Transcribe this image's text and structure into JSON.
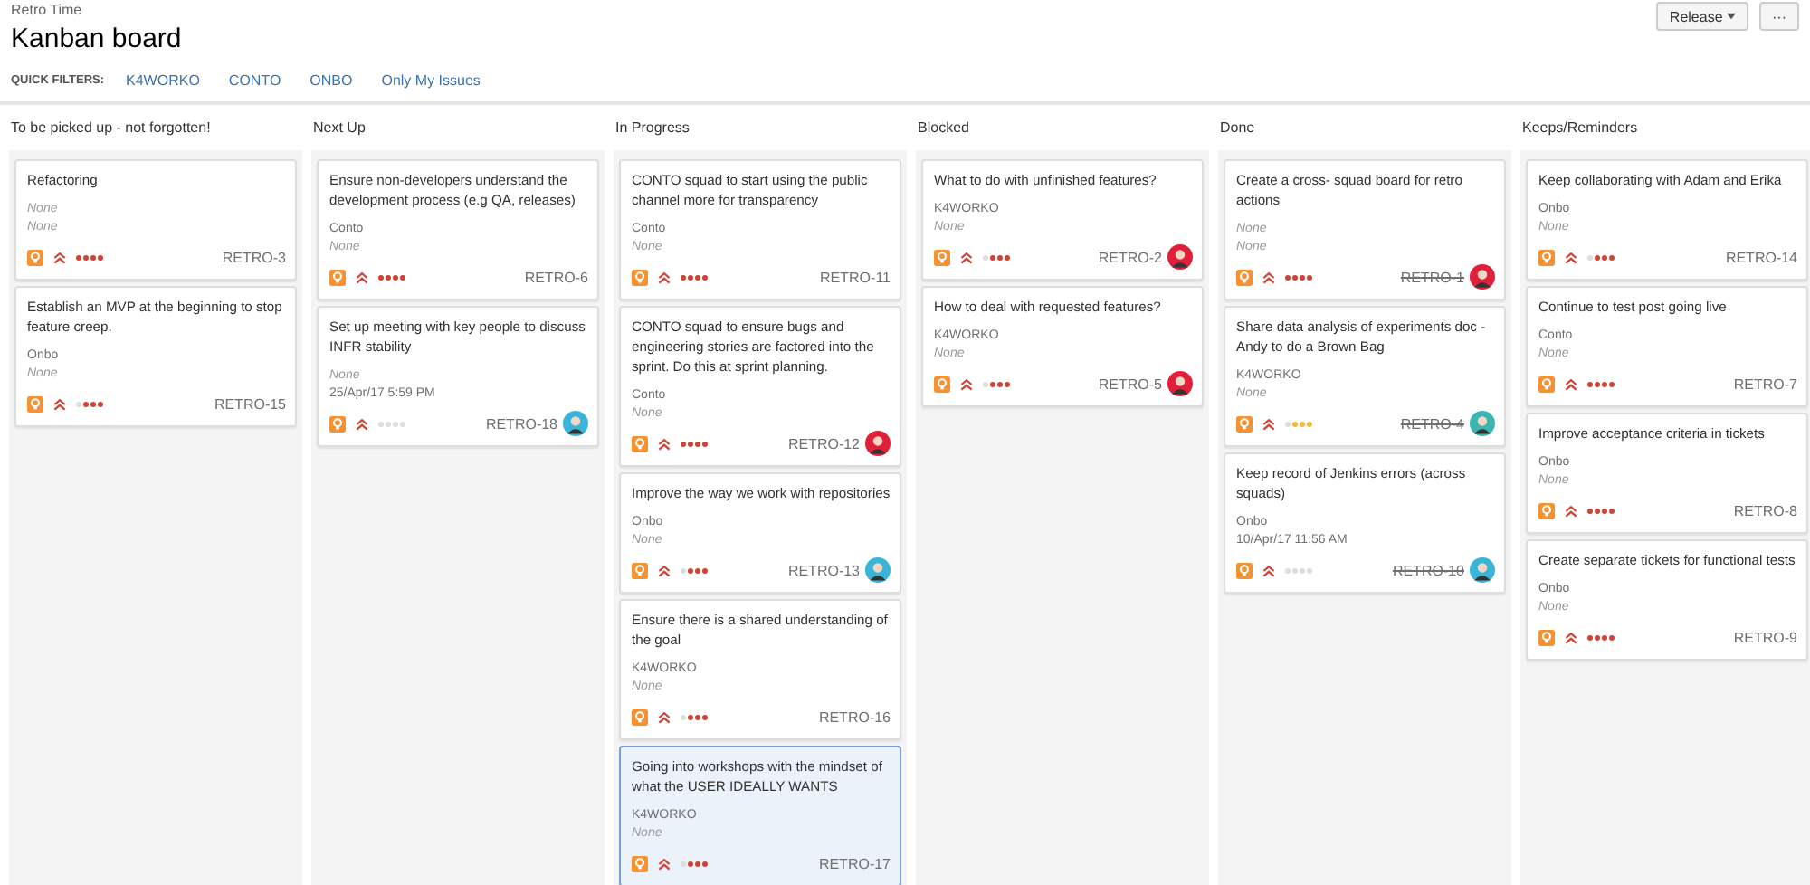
{
  "project": "Retro Time",
  "title": "Kanban board",
  "header_buttons": [
    {
      "label": "Release",
      "kind": "dropdown"
    },
    {
      "label": "···",
      "kind": "more"
    }
  ],
  "quick_filters": {
    "label": "QUICK FILTERS:",
    "items": [
      "K4WORKO",
      "CONTO",
      "ONBO",
      "Only My Issues"
    ]
  },
  "columns": [
    {
      "name": "To be picked up - not forgotten!",
      "cards": [
        {
          "summary": "Refactoring",
          "meta": [
            {
              "text": "None",
              "empty": true
            },
            {
              "text": "None",
              "empty": true
            }
          ],
          "stars": 4,
          "color": "#d04437",
          "key": "RETRO-3",
          "done": false,
          "selected": false
        },
        {
          "summary": "Establish an MVP at the beginning to stop feature creep.",
          "meta": [
            {
              "text": "Onbo",
              "empty": false
            },
            {
              "text": "None",
              "empty": true
            }
          ],
          "stars": 3,
          "color": "#d04437",
          "key": "RETRO-15",
          "done": false,
          "selected": false
        }
      ]
    },
    {
      "name": "Next Up",
      "cards": [
        {
          "summary": "Ensure non-developers understand the development process (e.g QA, releases)",
          "meta": [
            {
              "text": "Conto",
              "empty": false
            },
            {
              "text": "None",
              "empty": true
            }
          ],
          "stars": 4,
          "color": "#d04437",
          "key": "RETRO-6",
          "done": false,
          "selected": false
        },
        {
          "summary": "Set up meeting with key people to discuss INFR stability",
          "meta": [
            {
              "text": "None",
              "empty": true
            },
            {
              "text": "25/Apr/17 5:59 PM",
              "empty": false
            }
          ],
          "stars": 0,
          "key": "RETRO-18",
          "done": false,
          "selected": false,
          "avatar": {
            "color": "#3ab5d9"
          }
        }
      ]
    },
    {
      "name": "In Progress",
      "cards": [
        {
          "summary": "CONTO squad to start using the public channel more for transparency",
          "meta": [
            {
              "text": "Conto",
              "empty": false
            },
            {
              "text": "None",
              "empty": true
            }
          ],
          "stars": 4,
          "color": "#d04437",
          "key": "RETRO-11",
          "done": false,
          "selected": false
        },
        {
          "summary": "CONTO squad to ensure bugs and engineering stories are factored into the sprint. Do this at sprint planning.",
          "meta": [
            {
              "text": "Conto",
              "empty": false
            },
            {
              "text": "None",
              "empty": true
            }
          ],
          "stars": 4,
          "color": "#d04437",
          "key": "RETRO-12",
          "done": false,
          "selected": false,
          "avatar": {
            "color": "#e0203a"
          }
        },
        {
          "summary": "Improve the way we work with repositories",
          "meta": [
            {
              "text": "Onbo",
              "empty": false
            },
            {
              "text": "None",
              "empty": true
            }
          ],
          "stars": 3,
          "color": "#d04437",
          "key": "RETRO-13",
          "done": false,
          "selected": false,
          "avatar": {
            "color": "#3ab5d9"
          }
        },
        {
          "summary": "Ensure there is a shared understanding of the goal",
          "meta": [
            {
              "text": "K4WORKO",
              "empty": false
            },
            {
              "text": "None",
              "empty": true
            }
          ],
          "stars": 3,
          "color": "#d04437",
          "key": "RETRO-16",
          "done": false,
          "selected": false
        },
        {
          "summary": "Going into workshops with the mindset of what the USER IDEALLY WANTS",
          "meta": [
            {
              "text": "K4WORKO",
              "empty": false
            },
            {
              "text": "None",
              "empty": true
            }
          ],
          "stars": 3,
          "color": "#d04437",
          "key": "RETRO-17",
          "done": false,
          "selected": true
        }
      ]
    },
    {
      "name": "Blocked",
      "cards": [
        {
          "summary": "What to do with unfinished features?",
          "meta": [
            {
              "text": "K4WORKO",
              "empty": false
            },
            {
              "text": "None",
              "empty": true
            }
          ],
          "stars": 3,
          "color": "#d04437",
          "key": "RETRO-2",
          "done": false,
          "selected": false,
          "avatar": {
            "color": "#e0203a"
          }
        },
        {
          "summary": "How to deal with requested features?",
          "meta": [
            {
              "text": "K4WORKO",
              "empty": false
            },
            {
              "text": "None",
              "empty": true
            }
          ],
          "stars": 3,
          "color": "#d04437",
          "key": "RETRO-5",
          "done": false,
          "selected": false,
          "avatar": {
            "color": "#e0203a"
          }
        }
      ]
    },
    {
      "name": "Done",
      "cards": [
        {
          "summary": "Create a cross- squad board for retro actions",
          "meta": [
            {
              "text": "None",
              "empty": true
            },
            {
              "text": "None",
              "empty": true
            }
          ],
          "stars": 4,
          "color": "#d04437",
          "key": "RETRO-1",
          "done": true,
          "selected": false,
          "avatar": {
            "color": "#e0203a"
          }
        },
        {
          "summary": "Share data analysis of experiments doc - Andy to do a Brown Bag",
          "meta": [
            {
              "text": "K4WORKO",
              "empty": false
            },
            {
              "text": "None",
              "empty": true
            }
          ],
          "stars": 3,
          "color": "#f6b73c",
          "key": "RETRO-4",
          "done": true,
          "selected": false,
          "avatar": {
            "color": "#3ab5b0"
          }
        },
        {
          "summary": "Keep record of Jenkins errors (across squads)",
          "meta": [
            {
              "text": "Onbo",
              "empty": false
            },
            {
              "text": "10/Apr/17 11:56 AM",
              "empty": false
            }
          ],
          "stars": 0,
          "key": "RETRO-10",
          "done": true,
          "selected": false,
          "avatar": {
            "color": "#3ab5d9"
          }
        }
      ]
    },
    {
      "name": "Keeps/Reminders",
      "cards": [
        {
          "summary": "Keep collaborating with Adam and Erika",
          "meta": [
            {
              "text": "Onbo",
              "empty": false
            },
            {
              "text": "None",
              "empty": true
            }
          ],
          "stars": 3,
          "color": "#d04437",
          "key": "RETRO-14",
          "done": false,
          "selected": false
        },
        {
          "summary": "Continue to test post going live",
          "meta": [
            {
              "text": "Conto",
              "empty": false
            },
            {
              "text": "None",
              "empty": true
            }
          ],
          "stars": 4,
          "color": "#d04437",
          "key": "RETRO-7",
          "done": false,
          "selected": false
        },
        {
          "summary": "Improve acceptance criteria in tickets",
          "meta": [
            {
              "text": "Onbo",
              "empty": false
            },
            {
              "text": "None",
              "empty": true
            }
          ],
          "stars": 4,
          "color": "#d04437",
          "key": "RETRO-8",
          "done": false,
          "selected": false
        },
        {
          "summary": "Create separate tickets for functional tests",
          "meta": [
            {
              "text": "Onbo",
              "empty": false
            },
            {
              "text": "None",
              "empty": true
            }
          ],
          "stars": 4,
          "color": "#d04437",
          "key": "RETRO-9",
          "done": false,
          "selected": false
        }
      ]
    }
  ]
}
